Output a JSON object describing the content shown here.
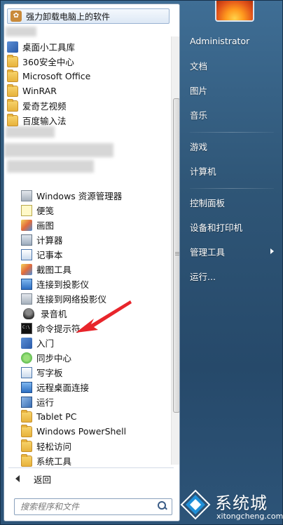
{
  "pinned": {
    "label": "强力卸载电脑上的软件"
  },
  "programs": [
    {
      "label": "桌面小工具库",
      "icon": "gadgets-icon",
      "level": 0
    },
    {
      "label": "360安全中心",
      "icon": "folder-icon",
      "level": 0
    },
    {
      "label": "Microsoft Office",
      "icon": "folder-icon",
      "level": 0
    },
    {
      "label": "WinRAR",
      "icon": "folder-icon",
      "level": 0
    },
    {
      "label": "爱奇艺视频",
      "icon": "folder-icon",
      "level": 0
    },
    {
      "label": "百度输入法",
      "icon": "folder-icon",
      "level": 0
    }
  ],
  "accessories": [
    {
      "label": "Windows 资源管理器",
      "icon": "explorer-icon"
    },
    {
      "label": "便笺",
      "icon": "sticky-notes-icon"
    },
    {
      "label": "画图",
      "icon": "paint-icon"
    },
    {
      "label": "计算器",
      "icon": "calculator-icon"
    },
    {
      "label": "记事本",
      "icon": "notepad-icon"
    },
    {
      "label": "截图工具",
      "icon": "snipping-tool-icon"
    },
    {
      "label": "连接到投影仪",
      "icon": "projector-icon"
    },
    {
      "label": "连接到网络投影仪",
      "icon": "network-projector-icon"
    },
    {
      "label": "录音机",
      "icon": "microphone-icon"
    },
    {
      "label": "命令提示符",
      "icon": "command-prompt-icon"
    },
    {
      "label": "入门",
      "icon": "getting-started-icon"
    },
    {
      "label": "同步中心",
      "icon": "sync-center-icon"
    },
    {
      "label": "写字板",
      "icon": "wordpad-icon"
    },
    {
      "label": "远程桌面连接",
      "icon": "remote-desktop-icon"
    },
    {
      "label": "运行",
      "icon": "run-icon"
    },
    {
      "label": "Tablet PC",
      "icon": "folder-icon"
    },
    {
      "label": "Windows PowerShell",
      "icon": "folder-icon"
    },
    {
      "label": "轻松访问",
      "icon": "folder-icon"
    },
    {
      "label": "系统工具",
      "icon": "folder-icon"
    }
  ],
  "back": {
    "label": "返回"
  },
  "search": {
    "placeholder": "搜索程序和文件"
  },
  "right": {
    "user": "Administrator",
    "documents": "文档",
    "pictures": "图片",
    "music": "音乐",
    "games": "游戏",
    "computer": "计算机",
    "control_panel": "控制面板",
    "devices": "设备和打印机",
    "admin_tools": "管理工具",
    "run": "运行..."
  },
  "watermark": {
    "cn": "系统城",
    "en": "xitongcheng.com"
  },
  "colors": {
    "accent": "#2f5677",
    "arrow": "#e8252b"
  }
}
